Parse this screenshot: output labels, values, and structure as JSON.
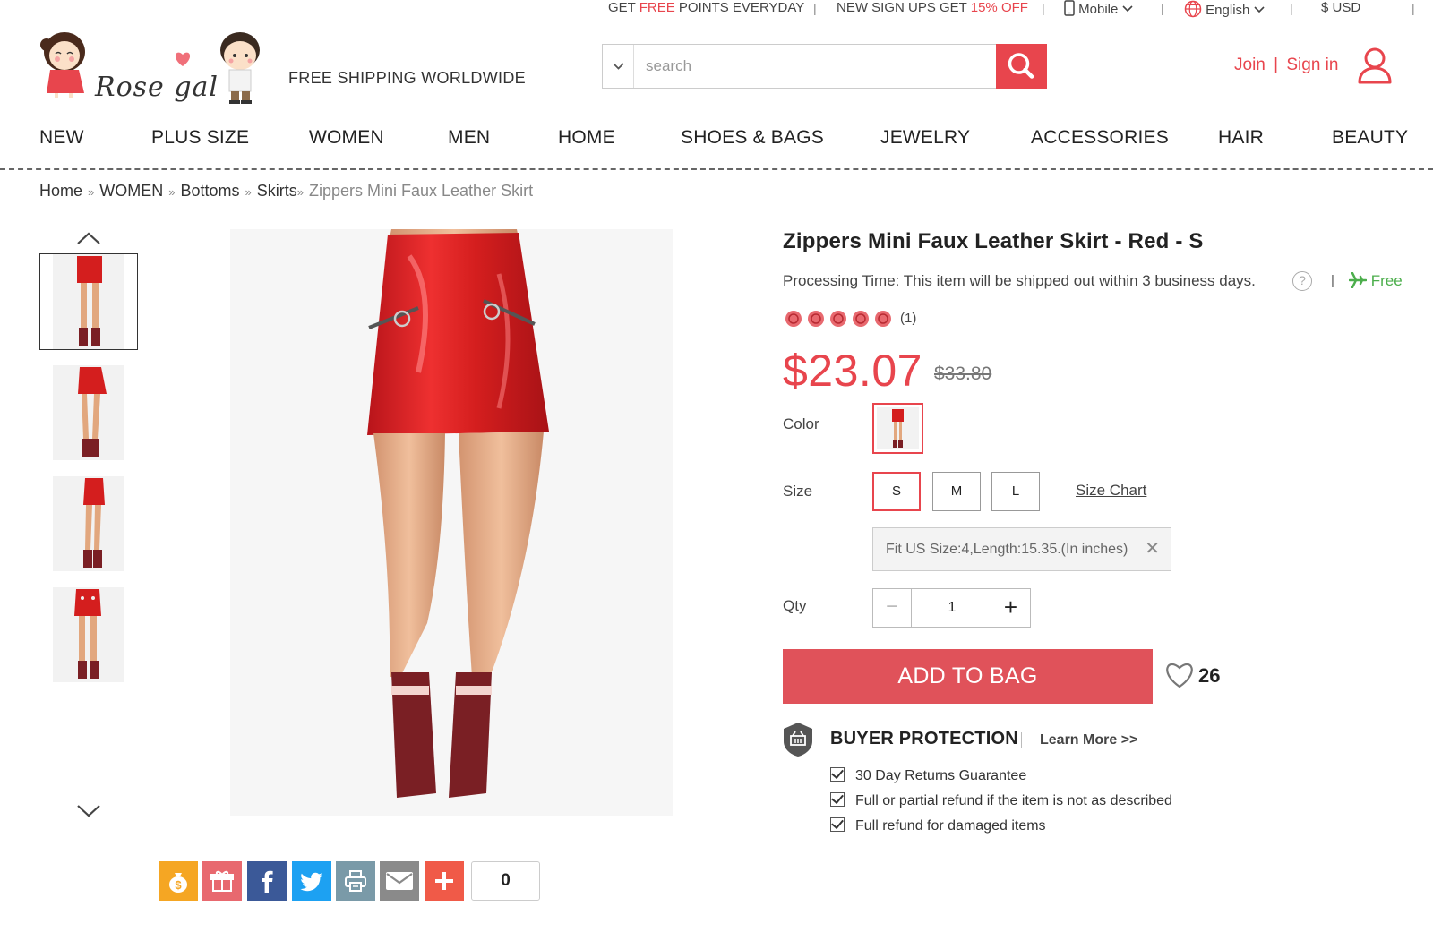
{
  "topbar": {
    "points_pre": "GET ",
    "points_free": "FREE",
    "points_post": " POINTS EVERYDAY",
    "signup_pre": "NEW SIGN UPS GET ",
    "signup_off": "15% OFF",
    "mobile": "Mobile",
    "language": "English",
    "currency": "$ USD",
    "separator": "|"
  },
  "header": {
    "logo_text": "Rose gal",
    "shipping": "FREE SHIPPING WORLDWIDE",
    "search_placeholder": "search",
    "join": "Join",
    "account_sep": "|",
    "signin": "Sign in"
  },
  "nav": [
    "NEW",
    "PLUS SIZE",
    "WOMEN",
    "MEN",
    "HOME",
    "SHOES & BAGS",
    "JEWELRY",
    "ACCESSORIES",
    "HAIR",
    "BEAUTY"
  ],
  "breadcrumb": {
    "items": [
      "Home",
      "WOMEN",
      "Bottoms",
      "Skirts"
    ],
    "sep": "»",
    "current": "Zippers Mini Faux Leather Skirt"
  },
  "product": {
    "title": "Zippers Mini Faux Leather Skirt - Red - S",
    "processing": "Processing Time: This item will be shipped out within 3 business days.",
    "help": "?",
    "sep": "|",
    "free": "Free",
    "rating": 5,
    "rating_count": "(1)",
    "price": "$23.07",
    "old_price": "$33.80",
    "color_label": "Color",
    "size_label": "Size",
    "sizes": [
      "S",
      "M",
      "L"
    ],
    "selected_size": "S",
    "size_chart": "Size Chart",
    "fit_note": "Fit US Size:4,Length:15.35.(In inches)",
    "fit_close": "✕",
    "qty_label": "Qty",
    "qty_minus": "−",
    "qty_value": "1",
    "qty_plus": "+",
    "add_to_bag": "ADD TO BAG",
    "favorites": "26"
  },
  "protection": {
    "title": "BUYER PROTECTION",
    "learn_more": "Learn More >>",
    "items": [
      "30 Day Returns Guarantee",
      "Full or partial refund if the item is not as described",
      "Full refund for damaged items"
    ]
  },
  "share": {
    "count": "0",
    "buttons": [
      {
        "name": "points-share",
        "color": "#f5a623"
      },
      {
        "name": "gift",
        "color": "#e8696f"
      },
      {
        "name": "facebook",
        "color": "#3b5998"
      },
      {
        "name": "twitter",
        "color": "#1da1f2"
      },
      {
        "name": "print",
        "color": "#7a9aa8"
      },
      {
        "name": "email",
        "color": "#8a8a8a"
      },
      {
        "name": "more",
        "color": "#f05a48"
      }
    ]
  },
  "colors": {
    "accent": "#e8454d",
    "button": "#e0525a",
    "free_green": "#4cae4c",
    "skirt": "#d41e1e",
    "boot": "#7a1f24"
  }
}
